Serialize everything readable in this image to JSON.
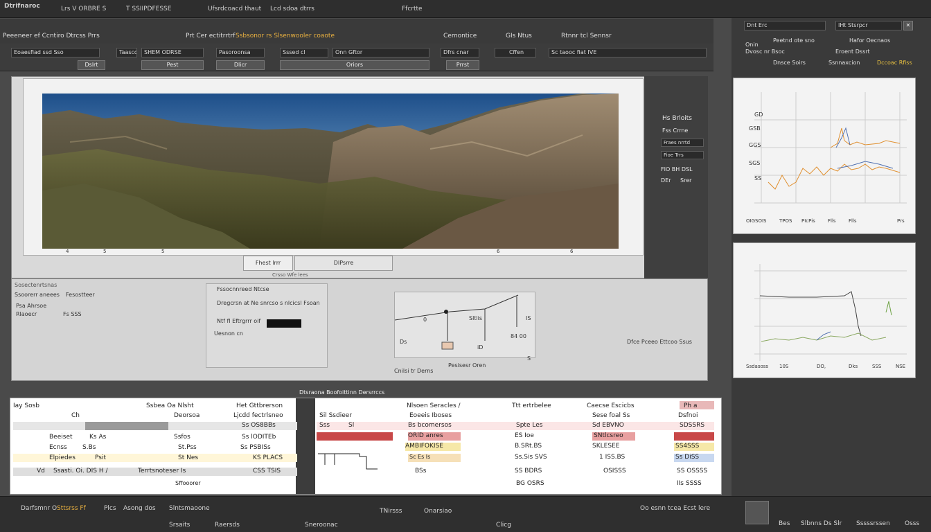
{
  "menubar": {
    "app_title": "Dtrifnaroc",
    "items": [
      "Lrs V ORBRE S",
      "T SSIIPDFESSE",
      "Ufsrdcoacd thaut",
      "Lcd sdoa dtrrs",
      "Ffcrtte"
    ]
  },
  "toolbar1": {
    "labels": [
      "Peeeneer ef Ccntiro Dtrcss Prrs",
      "Prt  Cer ectitrrtrf",
      "Ssbsonor rs Slsenwooler coaote",
      "Cemontice",
      "GIs Ntus",
      "Rtnnr tcl Sennsr"
    ]
  },
  "toolbar2": {
    "fields": [
      "Eoaesfiad ssd Sso",
      "Taasco",
      "SHEM ODRSE",
      "Pasoroonsa",
      "Sssed cl",
      "Onn Gftor",
      "Dfrs cnar",
      "Sc taooc fiat IVE",
      "Cffen"
    ],
    "buttons": [
      "Dslrt",
      "Pest",
      "Dlicr",
      "Oriors",
      "Prrst"
    ]
  },
  "canvas": {
    "ruler_ticks": [
      "4",
      "5",
      "5",
      "6",
      "6"
    ],
    "tabs": [
      "Fhest lrrr",
      "DIPsrre"
    ],
    "caption": "Crsso Wfe lees"
  },
  "right_props": {
    "title": "Hs Brloits",
    "subtitle": "Fss Crrne",
    "field1": "Fraes nrrtd",
    "field2": "Fioe Trrs",
    "label3": "FIO BH DSL",
    "label4": "DEr",
    "label5": "Srer"
  },
  "bottom_panel": {
    "left_labels": [
      "Sosectenrtsnas",
      "Ssoorerr aneees",
      "Fesostteer",
      "Psa Ahrsoe",
      "Rlaoecr",
      "Fs SSS"
    ],
    "form_title": "Fssocnnreed Ntcse",
    "form_line": "Dregcrsn at Ne snrcso s nlcicsl Fsoan",
    "form_field_label": "Ntf fl Eftrgrrr oif",
    "form_field2": "Uesnon cn",
    "diagram_labels": [
      "0",
      "Sltlis",
      "Ds",
      "iD",
      "IS",
      "84 00",
      "S",
      "Pesisesr Oren"
    ],
    "right_note": "Dfce Pceeo Ettcoo Ssus",
    "foot_note": "Cnilsi tr Derns"
  },
  "side_panel": {
    "header_fields": [
      "Dnt Erc",
      "IHt Stsrpcr",
      "Onin",
      "Peetnd ote sno",
      "Hafor Oecnaos",
      "Dvosc nr Bsoc",
      "Eroent Dssrt",
      "Dnsce Soirs",
      "Ssnnaxcion",
      "Dccoac Rfiss"
    ],
    "chart1": {
      "y_ticks": [
        "GD",
        "GSB",
        "GGS",
        "SGS",
        "SS"
      ],
      "x_ticks": [
        "OIGSOIS",
        "TPOS",
        "PIcPis",
        "Flls",
        "Flls",
        "Prs"
      ]
    },
    "chart2": {
      "x_ticks": [
        "Ssdasoss",
        "10S",
        "DO,",
        "Dks",
        "SSS",
        "NSE"
      ]
    }
  },
  "tables": {
    "section_title": "Dtsraona Boofoittinn Dersrrccs",
    "left": {
      "headers": [
        "Iay Sosb",
        "Ssbea Oa Nlsht",
        "Het Gttbrerson"
      ],
      "subheaders": [
        "Ch",
        "Deorsoa",
        "Ljcdd fectrlsneo"
      ],
      "rows": [
        [
          "",
          "",
          "Ss OS8BBs"
        ],
        [
          "Beeiset",
          "Ks As",
          "Ssfos",
          "Ss lODITEb"
        ],
        [
          "Ecnss",
          "S.Bs",
          "St.Pss",
          "Ss PSBISs"
        ],
        [
          "Elpiedes",
          "Psit",
          "St Nes",
          "KS PLACS"
        ],
        [
          "Vd",
          "Ssasti. Oi. DIS H /",
          "Terrtsnoteser Is",
          "CSS TSIS"
        ],
        [
          "",
          "",
          "Sffooorer",
          ""
        ]
      ]
    },
    "right": {
      "headers": [
        "Nlsoen Seracles /",
        "Ttt ertrbelee",
        "Caecse Escicbs",
        "Ph a"
      ],
      "subheaders": [
        "Sil Ssdieer",
        "Eoeeis Iboses",
        "Sese foal Ss",
        "Dsfnoi"
      ],
      "rows": [
        [
          "Sss",
          "Sl",
          "Bs bcomersos",
          "Spte Les",
          "Sd EBVNO",
          "SDSSRS"
        ],
        [
          "",
          "",
          "ORlD anres",
          "ES Ioe",
          "SNtlcsreo",
          ""
        ],
        [
          "",
          "",
          "AMBIFOKISE",
          "B.SRt.BS",
          "SKLESEE",
          "SS4SSS"
        ],
        [
          "",
          "",
          "Sc Es Is",
          "Ss.Sis SVS",
          "1 ISS.BS",
          "Ss DiSS"
        ],
        [
          "",
          "",
          "BSs",
          "SS BDRS",
          "OSISSS",
          "SS OSSSS"
        ],
        [
          "",
          "",
          "",
          "BG OSRS",
          "",
          "IIs SSSS"
        ]
      ]
    }
  },
  "statusbar": {
    "items": [
      "Darfsmnr O",
      "Sttsrss Ff",
      "Plcs",
      "Asong dos",
      "Slntsmaoone",
      "Srsaits",
      "Raersds",
      "Sneroonac",
      "TNirsss",
      "Onarsiao",
      "Clicg",
      "Oo esnn tcea Ecst lere",
      "Bes",
      "Slbnns Ds Slr",
      "Sssssrssen",
      "Osss"
    ]
  },
  "colors": {
    "accent_red": "#c84848",
    "accent_orange": "#e0a040",
    "accent_yellow": "#e8c840",
    "accent_blue": "#5a78b8"
  }
}
